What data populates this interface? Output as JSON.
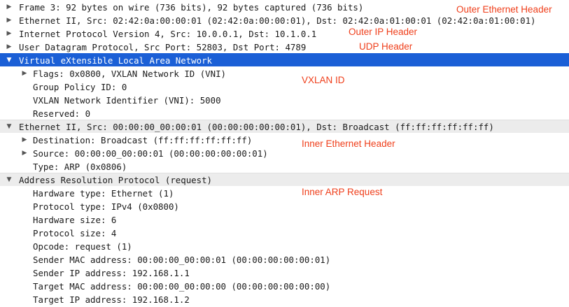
{
  "packet_details": {
    "rows": [
      {
        "text": "Frame 3: 92 bytes on wire (736 bits), 92 bytes captured (736 bits)",
        "toggle": "collapsed"
      },
      {
        "text": "Ethernet II, Src: 02:42:0a:00:00:01 (02:42:0a:00:00:01), Dst: 02:42:0a:01:00:01 (02:42:0a:01:00:01)",
        "toggle": "collapsed"
      },
      {
        "text": "Internet Protocol Version 4, Src: 10.0.0.1, Dst: 10.1.0.1",
        "toggle": "collapsed"
      },
      {
        "text": "User Datagram Protocol, Src Port: 52803, Dst Port: 4789",
        "toggle": "collapsed"
      },
      {
        "text": "Virtual eXtensible Local Area Network",
        "toggle": "expanded",
        "selected": true
      },
      {
        "text": "Flags: 0x0800, VXLAN Network ID (VNI)",
        "toggle": "collapsed"
      },
      {
        "text": "Group Policy ID: 0"
      },
      {
        "text": "VXLAN Network Identifier (VNI): 5000"
      },
      {
        "text": "Reserved: 0"
      },
      {
        "text": "Ethernet II, Src: 00:00:00_00:00:01 (00:00:00:00:00:01), Dst: Broadcast (ff:ff:ff:ff:ff:ff)",
        "toggle": "expanded"
      },
      {
        "text": "Destination: Broadcast (ff:ff:ff:ff:ff:ff)",
        "toggle": "collapsed"
      },
      {
        "text": "Source: 00:00:00_00:00:01 (00:00:00:00:00:01)",
        "toggle": "collapsed"
      },
      {
        "text": "Type: ARP (0x0806)"
      },
      {
        "text": "Address Resolution Protocol (request)",
        "toggle": "expanded"
      },
      {
        "text": "Hardware type: Ethernet (1)"
      },
      {
        "text": "Protocol type: IPv4 (0x0800)"
      },
      {
        "text": "Hardware size: 6"
      },
      {
        "text": "Protocol size: 4"
      },
      {
        "text": "Opcode: request (1)"
      },
      {
        "text": "Sender MAC address: 00:00:00_00:00:01 (00:00:00:00:00:01)"
      },
      {
        "text": "Sender IP address: 192.168.1.1"
      },
      {
        "text": "Target MAC address: 00:00:00_00:00:00 (00:00:00:00:00:00)"
      },
      {
        "text": "Target IP address: 192.168.1.2"
      }
    ]
  },
  "annotations": {
    "outer_ethernet": "Outer Ethernet Header",
    "outer_ip": "Outer IP Header",
    "udp": "UDP Header",
    "vxlan_id": "VXLAN ID",
    "inner_ethernet": "Inner Ethernet Header",
    "inner_arp": "Inner ARP Request"
  },
  "colors": {
    "selection": "#1b5fd6",
    "annotation": "#ef3e1a",
    "band": "#ececec"
  },
  "icons": {
    "collapsed": "triangle-right-icon",
    "expanded": "triangle-down-icon"
  }
}
